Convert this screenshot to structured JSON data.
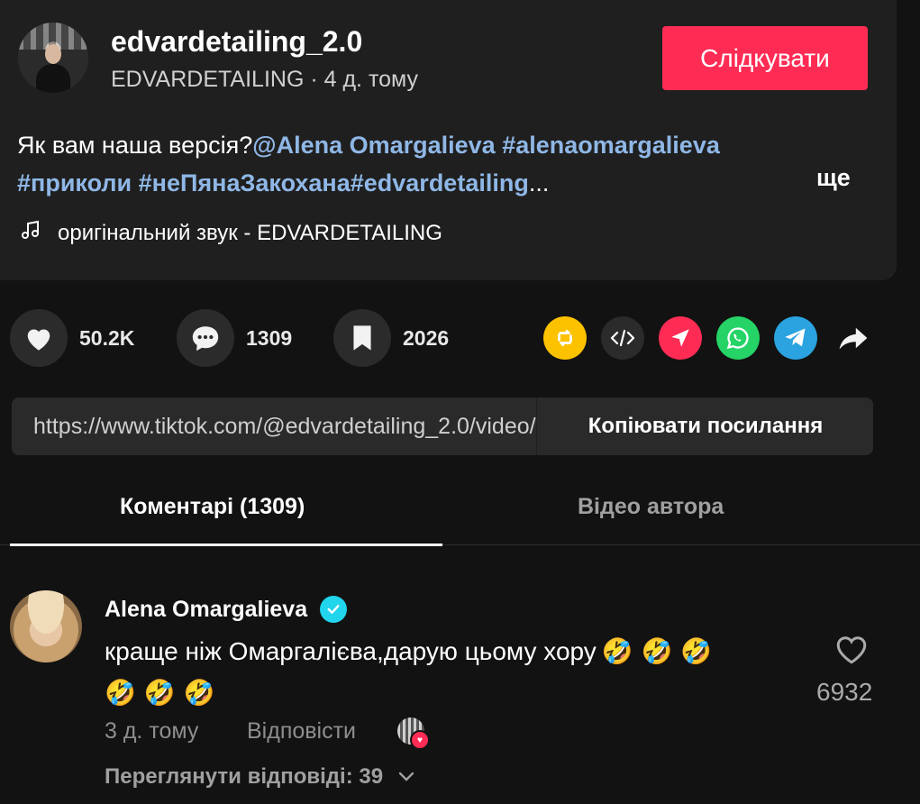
{
  "author": {
    "username": "edvardetailing_2.0",
    "nickname": "EDVARDETAILING",
    "separator": " · ",
    "posted": "4 д. тому",
    "follow_label": "Слідкувати"
  },
  "description": {
    "text": "Як вам наша версія?",
    "mention": "@Alena Omargalieva",
    "tag1": " #alenaomargalieva",
    "tag2": "#приколи",
    "tag3": " #неПянаЗакохана",
    "tag4": "#edvardetailing",
    "ellipsis": "...",
    "more_label": "ще"
  },
  "sound": {
    "icon": "music-note-icon",
    "label": "оригінальний звук - EDVARDETAILING"
  },
  "stats": {
    "likes": "50.2K",
    "comments": "1309",
    "saves": "2026"
  },
  "share_icons": [
    {
      "name": "repost-icon",
      "color": "#fcc200"
    },
    {
      "name": "embed-icon",
      "color": "#2b2b2b"
    },
    {
      "name": "send-icon",
      "color": "#fe2c55"
    },
    {
      "name": "whatsapp-icon",
      "color": "#25d366"
    },
    {
      "name": "telegram-icon",
      "color": "#2aa3e0"
    },
    {
      "name": "share-icon",
      "color": "#121212"
    }
  ],
  "link": {
    "url": "https://www.tiktok.com/@edvardetailing_2.0/video/",
    "copy_label": "Копіювати посилання"
  },
  "tabs": {
    "comments": "Коментарі (1309)",
    "author_videos": "Відео автора"
  },
  "comment": {
    "author": "Alena Omargalieva",
    "text": "краще ніж Омаргалієва,дарую цьому хору",
    "emoji_line1": "🤣 🤣 🤣",
    "emoji_line2": "🤣 🤣 🤣",
    "likes": "6932",
    "time": "3 д. тому",
    "reply_label": "Відповісти",
    "view_replies": "Переглянути відповіді: 39"
  }
}
